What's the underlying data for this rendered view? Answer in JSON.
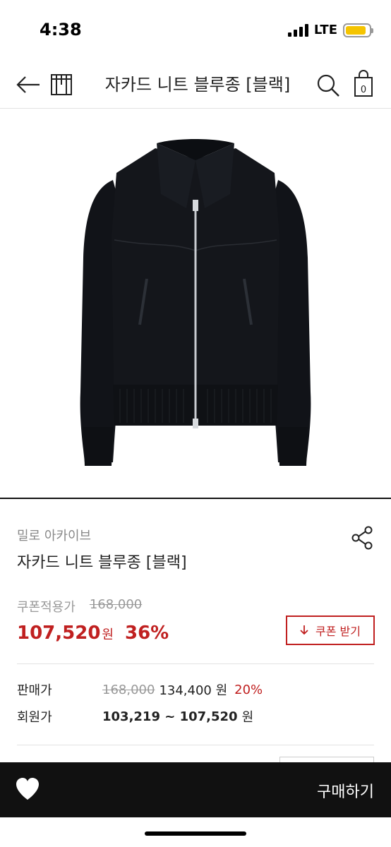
{
  "status": {
    "time": "4:38",
    "network": "LTE"
  },
  "nav": {
    "title": "자카드 니트 블루종 [블랙]"
  },
  "hero": {
    "alt": "product-photo"
  },
  "product": {
    "brand": "밀로 아카이브",
    "name": "자카드 니트 블루종 [블랙]"
  },
  "pricing": {
    "coupon_label": "쿠폰적용가",
    "coupon_original": "168,000",
    "coupon_price": "107,520",
    "coupon_unit": "원",
    "coupon_discount": "36%",
    "coupon_button": "쿠폰 받기",
    "sale_label": "판매가",
    "sale_original": "168,000",
    "sale_price": "134,400 원",
    "sale_discount": "20%",
    "member_label": "회원가",
    "member_range": "103,219 ~ 107,520",
    "member_unit": "원"
  },
  "bottom_bar": {
    "buy_label": "구매하기"
  },
  "colors": {
    "accent": "#c02020",
    "bar": "#111111"
  },
  "icons": [
    "back-arrow-icon",
    "store-icon",
    "search-icon",
    "bag-icon",
    "share-icon",
    "download-arrow-icon",
    "heart-icon"
  ],
  "cart_count": "0"
}
